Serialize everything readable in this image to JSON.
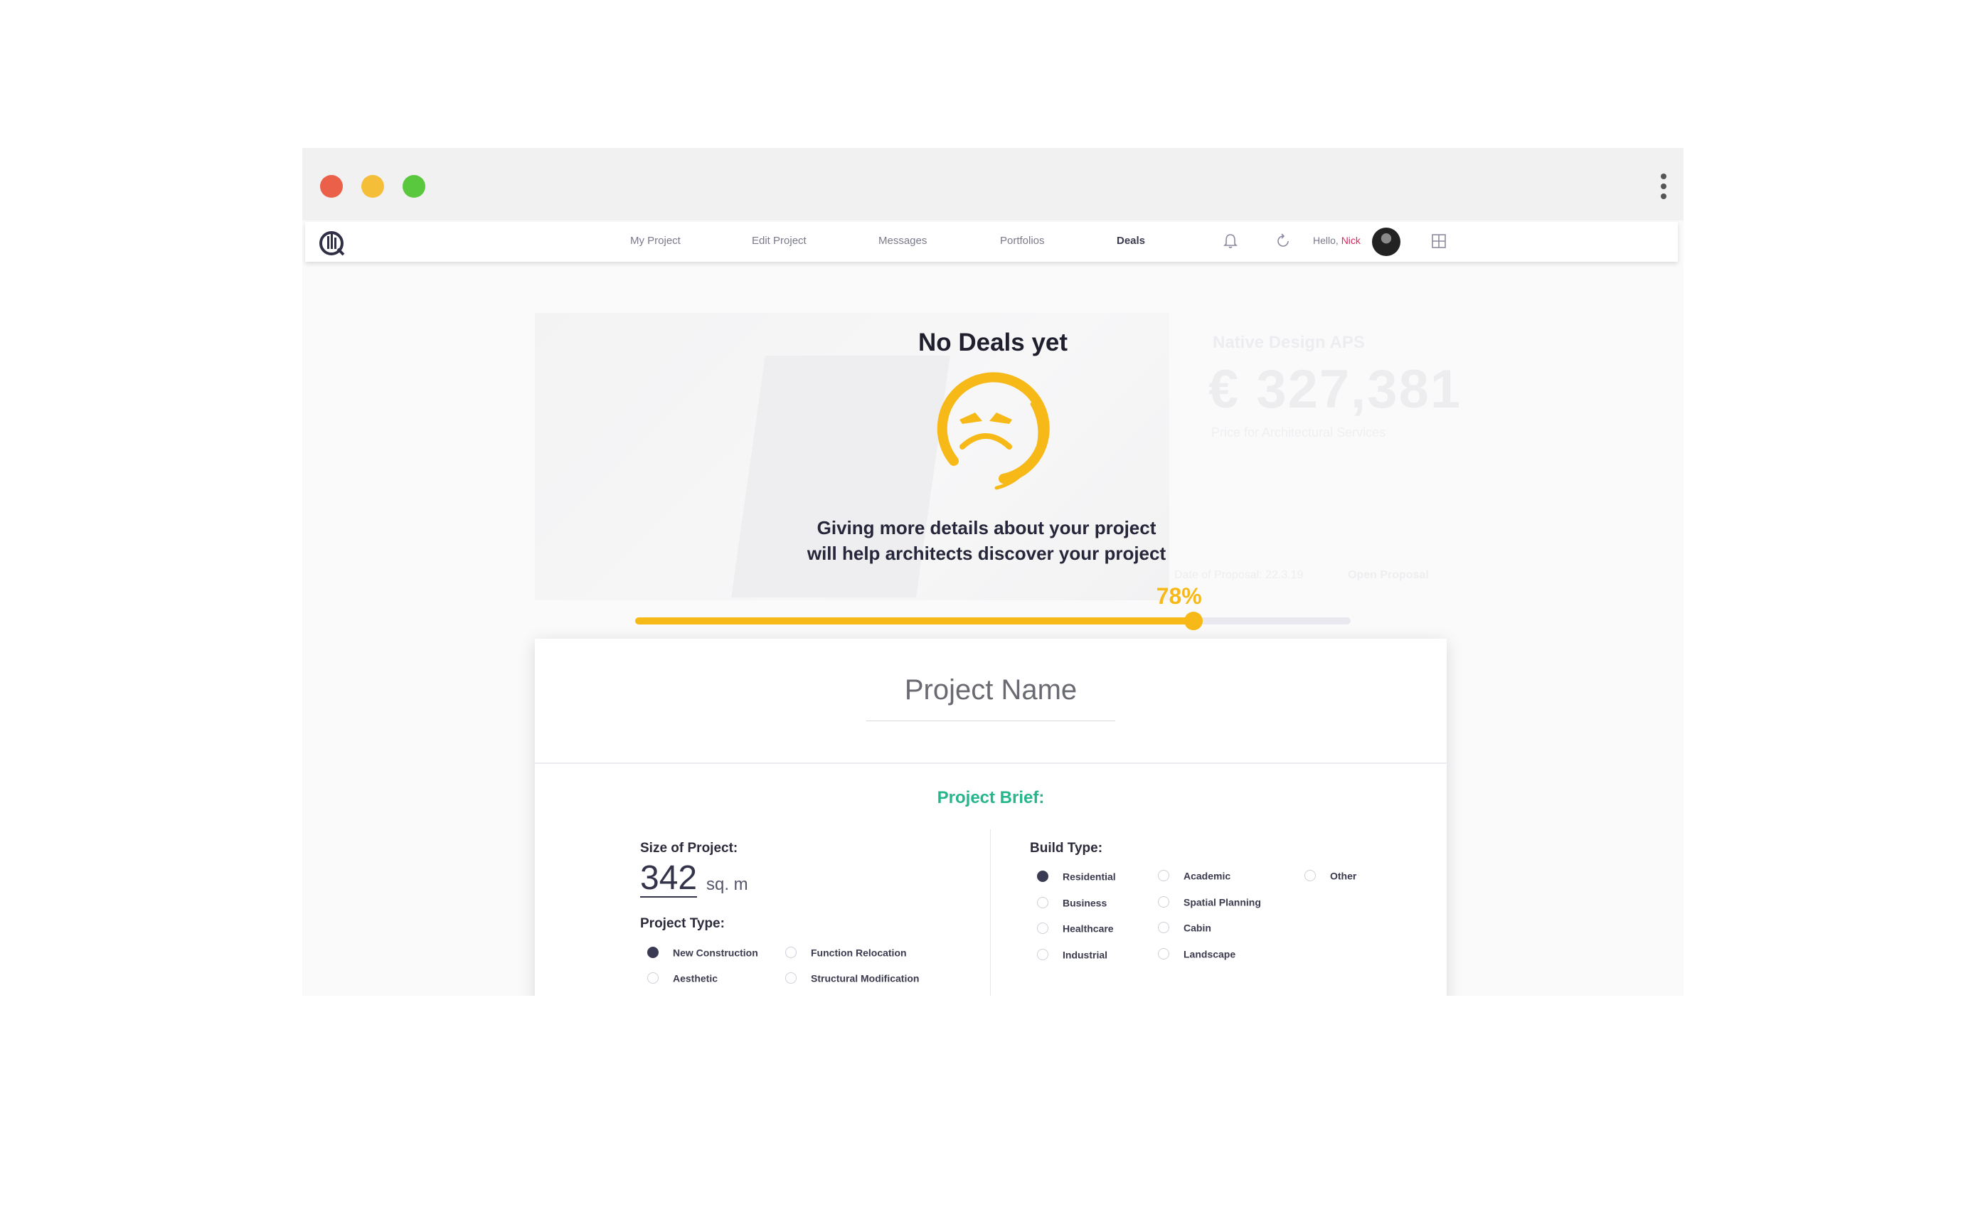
{
  "nav": {
    "links": [
      "My Project",
      "Edit Project",
      "Messages",
      "Portfolios",
      "Deals"
    ],
    "active": "Deals",
    "hello": "Hello,",
    "user_name": "Nick"
  },
  "background": {
    "company": "Native Design APS",
    "amount": "€ 327,381",
    "subtitle": "Price for Architectural Services",
    "row_left": "Date of Proposal: 22.3.19",
    "row_right": "Open Proposal"
  },
  "overlay": {
    "title": "No Deals yet",
    "message_line1": "Giving more details about your project",
    "message_line2": "will help architects discover your project"
  },
  "progress": {
    "percent": 78,
    "label": "78%",
    "color": "#f6b917"
  },
  "card": {
    "title": "Project Name",
    "brief_title": "Project Brief:",
    "size_label": "Size of Project:",
    "size_value": "342",
    "size_unit": "sq. m",
    "project_type_label": "Project Type:",
    "project_types": [
      {
        "label": "New Construction",
        "selected": true
      },
      {
        "label": "Function Relocation",
        "selected": false
      },
      {
        "label": "Aesthetic",
        "selected": false
      },
      {
        "label": "Structural Modification",
        "selected": false
      }
    ],
    "build_type_label": "Build Type:",
    "build_types": [
      {
        "label": "Residential",
        "selected": true
      },
      {
        "label": "Academic",
        "selected": false
      },
      {
        "label": "Other",
        "selected": false
      },
      {
        "label": "Business",
        "selected": false
      },
      {
        "label": "Spatial  Planning",
        "selected": false
      },
      {
        "label": "Healthcare",
        "selected": false
      },
      {
        "label": "Cabin",
        "selected": false
      },
      {
        "label": "Industrial",
        "selected": false
      },
      {
        "label": "Landscape",
        "selected": false
      }
    ]
  },
  "colors": {
    "accent_yellow": "#f6b917",
    "brief_green": "#26b68b",
    "username_pink": "#e0245e"
  }
}
